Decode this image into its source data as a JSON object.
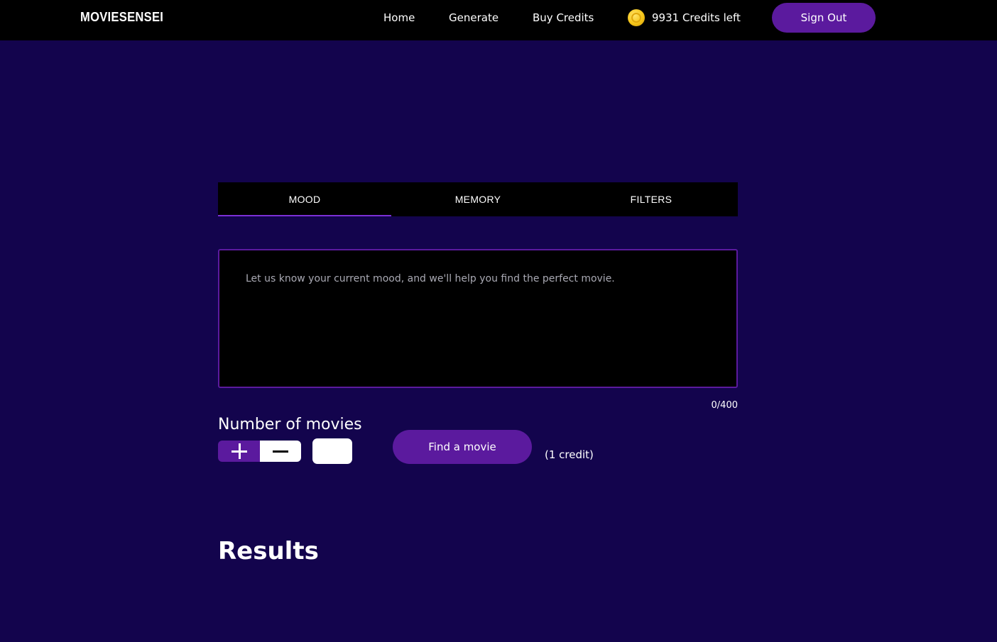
{
  "navbar": {
    "brand": "MOVIESENSEI",
    "links": {
      "home": "Home",
      "generate": "Generate",
      "buy_credits": "Buy Credits"
    },
    "credits": {
      "icon": "coin-icon",
      "text": "9931 Credits left"
    },
    "sign_out_label": "Sign Out"
  },
  "tabs": [
    {
      "label": "MOOD",
      "active": true
    },
    {
      "label": "MEMORY",
      "active": false
    },
    {
      "label": "FILTERS",
      "active": false
    }
  ],
  "mood_input": {
    "placeholder": "Let us know your current mood, and we'll help you find the perfect movie.",
    "value": "",
    "char_count": "0/400"
  },
  "movie_count": {
    "label": "Number of movies",
    "plus_icon": "plus-icon",
    "minus_icon": "minus-icon",
    "value": ""
  },
  "actions": {
    "find_label": "Find a movie",
    "cost_label": "(1 credit)"
  },
  "results": {
    "heading": "Results"
  },
  "colors": {
    "background": "#13044d",
    "navbar": "#000000",
    "accent": "#5b1a9e",
    "tab_indicator": "#7b2fd6",
    "coin": "#f5c518"
  }
}
